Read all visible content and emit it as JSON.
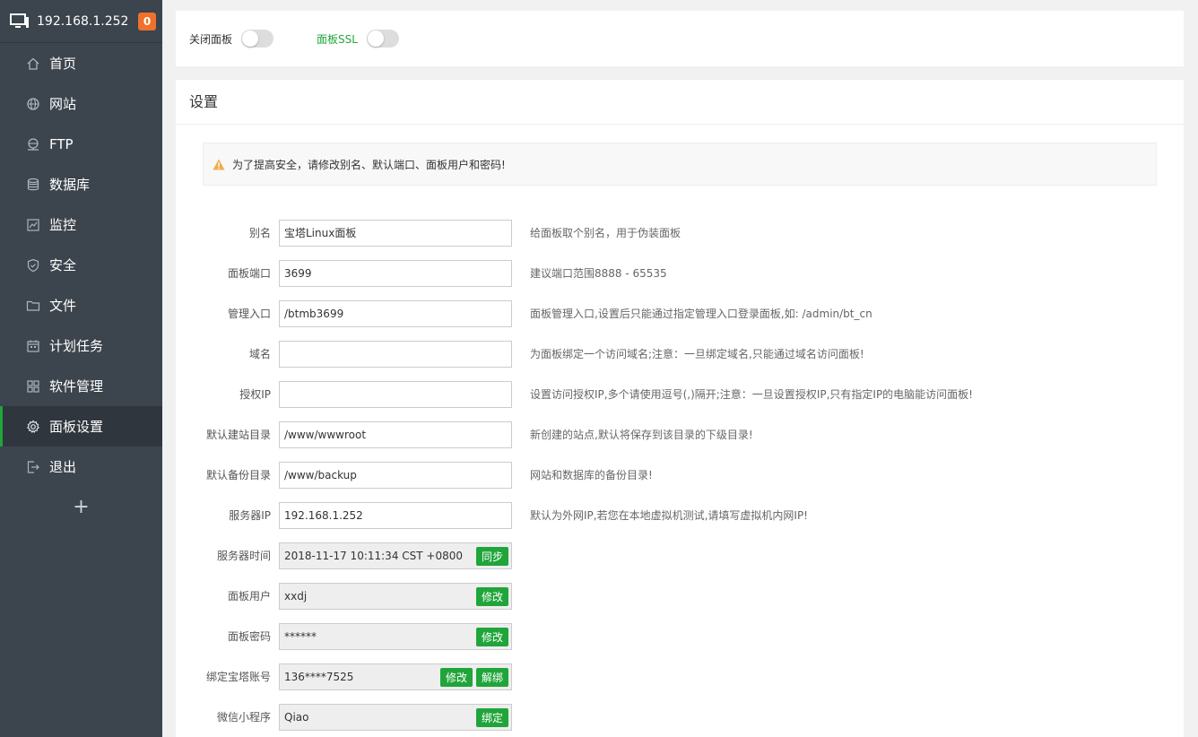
{
  "sidebar": {
    "host_ip": "192.168.1.252",
    "notify_count": "0",
    "items": [
      {
        "label": "首页",
        "icon": "home-icon"
      },
      {
        "label": "网站",
        "icon": "globe-icon"
      },
      {
        "label": "FTP",
        "icon": "ftp-icon"
      },
      {
        "label": "数据库",
        "icon": "database-icon"
      },
      {
        "label": "监控",
        "icon": "monitor-chart-icon"
      },
      {
        "label": "安全",
        "icon": "shield-icon"
      },
      {
        "label": "文件",
        "icon": "folder-icon"
      },
      {
        "label": "计划任务",
        "icon": "calendar-icon"
      },
      {
        "label": "软件管理",
        "icon": "grid-icon"
      },
      {
        "label": "面板设置",
        "icon": "gear-icon"
      },
      {
        "label": "退出",
        "icon": "logout-icon"
      }
    ],
    "active_index": 9,
    "add_label": "+"
  },
  "top": {
    "close_panel_label": "关闭面板",
    "close_panel_on": false,
    "ssl_label": "面板SSL",
    "ssl_on": false
  },
  "settings": {
    "title": "设置",
    "alert": "为了提高安全，请修改别名、默认端口、面板用户和密码!",
    "rows": [
      {
        "label": "别名",
        "value": "宝塔Linux面板",
        "hint": "给面板取个别名，用于伪装面板"
      },
      {
        "label": "面板端口",
        "value": "3699",
        "hint": "建议端口范围8888 - 65535"
      },
      {
        "label": "管理入口",
        "value": "/btmb3699",
        "hint": "面板管理入口,设置后只能通过指定管理入口登录面板,如: /admin/bt_cn"
      },
      {
        "label": "域名",
        "value": "",
        "hint": "为面板绑定一个访问域名;注意：一旦绑定域名,只能通过域名访问面板!"
      },
      {
        "label": "授权IP",
        "value": "",
        "hint": "设置访问授权IP,多个请使用逗号(,)隔开;注意：一旦设置授权IP,只有指定IP的电脑能访问面板!"
      },
      {
        "label": "默认建站目录",
        "value": "/www/wwwroot",
        "hint": "新创建的站点,默认将保存到该目录的下级目录!"
      },
      {
        "label": "默认备份目录",
        "value": "/www/backup",
        "hint": "网站和数据库的备份目录!"
      },
      {
        "label": "服务器IP",
        "value": "192.168.1.252",
        "hint": "默认为外网IP,若您在本地虚拟机测试,请填写虚拟机内网IP!"
      },
      {
        "label": "服务器时间",
        "value": "2018-11-17 10:11:34 CST +0800",
        "buttons": [
          "同步"
        ]
      },
      {
        "label": "面板用户",
        "value": "xxdj",
        "buttons": [
          "修改"
        ]
      },
      {
        "label": "面板密码",
        "value": "******",
        "buttons": [
          "修改"
        ]
      },
      {
        "label": "绑定宝塔账号",
        "value": "136****7525",
        "buttons": [
          "修改",
          "解绑"
        ]
      },
      {
        "label": "微信小程序",
        "value": "Qiao",
        "buttons": [
          "绑定"
        ]
      }
    ]
  },
  "colors": {
    "sidebar_bg": "#3c444d",
    "accent_green": "#20a53a",
    "badge_orange": "#f0712c"
  }
}
